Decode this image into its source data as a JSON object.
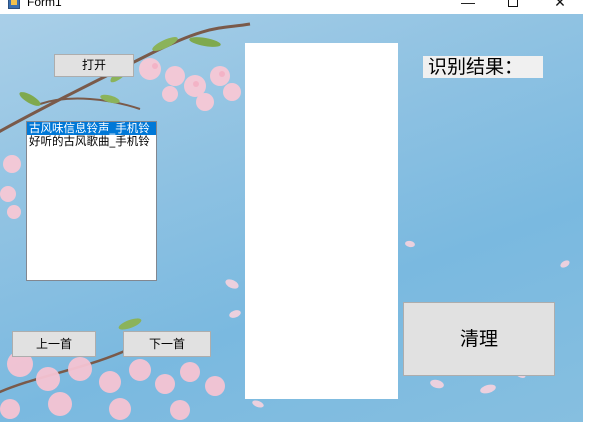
{
  "window": {
    "title": "Form1",
    "minimize_glyph": "—",
    "close_glyph": "✕"
  },
  "buttons": {
    "open_label": "打开",
    "prev_label": "上一首",
    "next_label": "下一首",
    "clear_label": "清理"
  },
  "playlist": {
    "items": [
      "古风味信息铃声_手机铃",
      "好听的古风歌曲_手机铃"
    ],
    "selected_index": 0
  },
  "result": {
    "label": "识别结果："
  },
  "colors": {
    "background": "#7ab9e0",
    "selection": "#0078d7",
    "button_face": "#e1e1e1"
  }
}
